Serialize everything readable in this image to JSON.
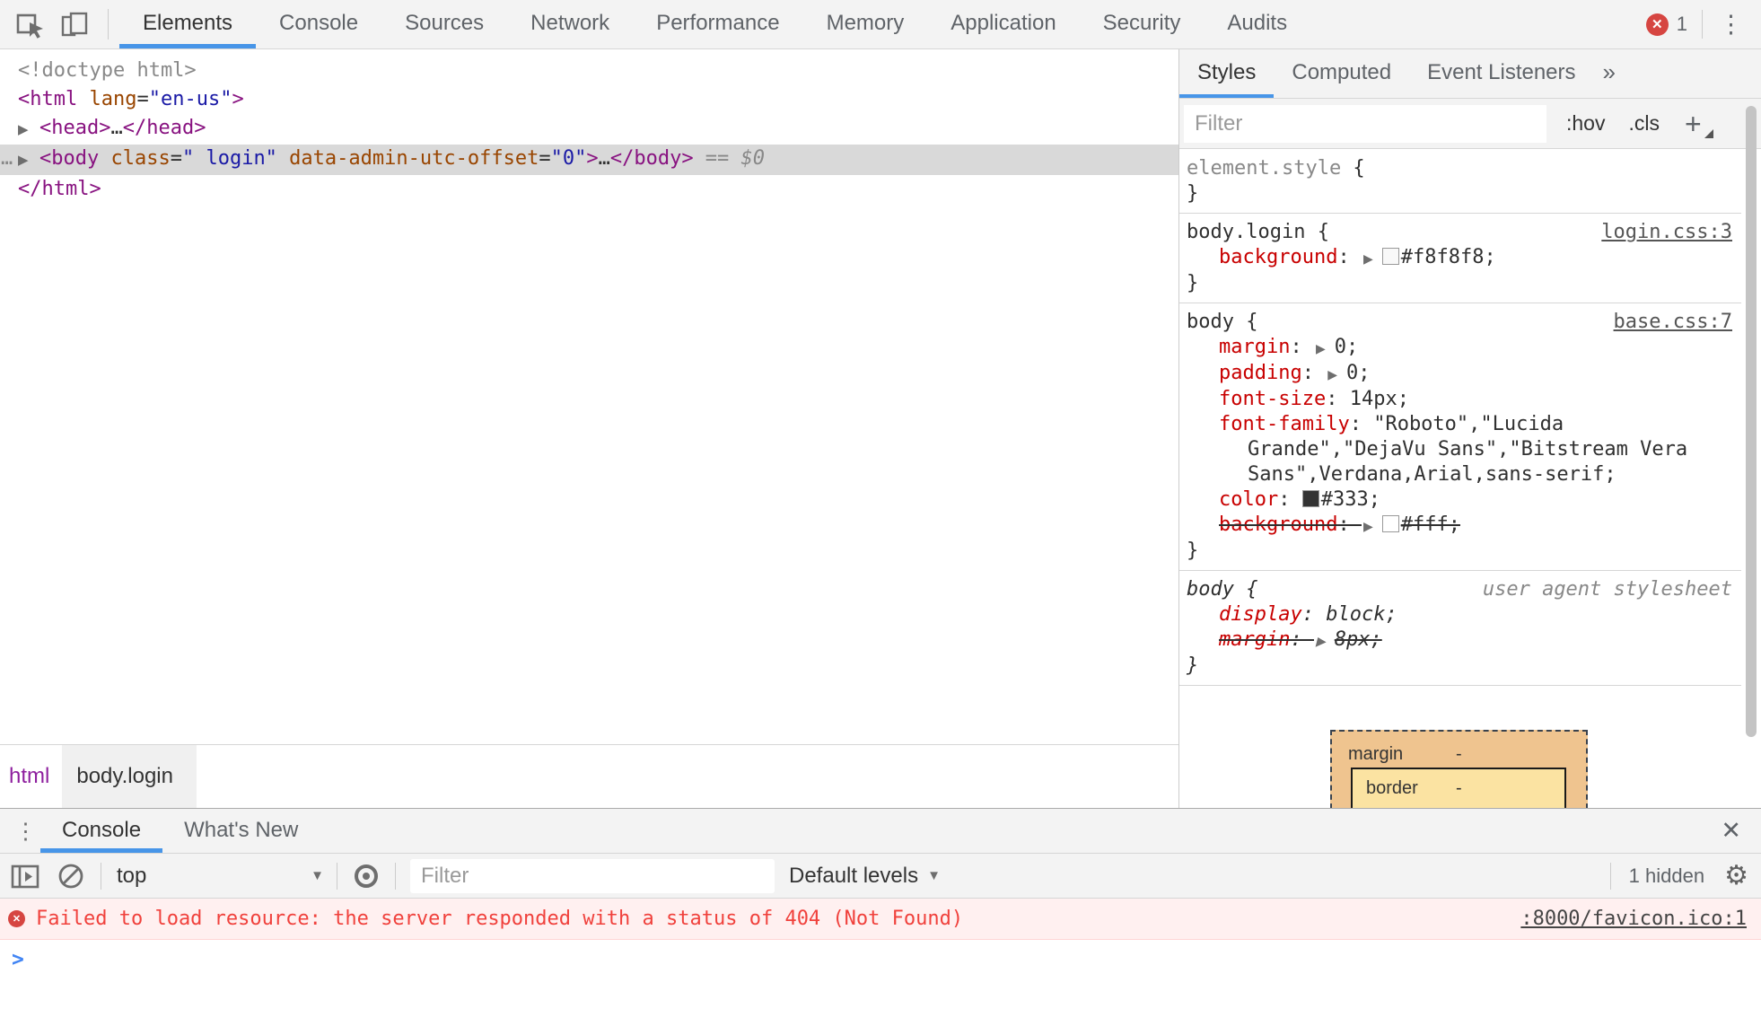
{
  "main_tabbar": {
    "tabs": [
      {
        "label": "Elements",
        "selected": true
      },
      {
        "label": "Console",
        "selected": false
      },
      {
        "label": "Sources",
        "selected": false
      },
      {
        "label": "Network",
        "selected": false
      },
      {
        "label": "Performance",
        "selected": false
      },
      {
        "label": "Memory",
        "selected": false
      },
      {
        "label": "Application",
        "selected": false
      },
      {
        "label": "Security",
        "selected": false
      },
      {
        "label": "Audits",
        "selected": false
      }
    ],
    "error_count": "1"
  },
  "elements_panel": {
    "code_lines": [
      {
        "tokens": [
          {
            "text": "<!doctype html>",
            "type": "comment"
          }
        ]
      },
      {
        "tokens": [
          {
            "text": "<html",
            "type": "tag"
          },
          {
            "text": " lang",
            "type": "attr"
          },
          {
            "text": "=",
            "type": "plain"
          },
          {
            "text": "\"en-us\"",
            "type": "value"
          },
          {
            "text": ">",
            "type": "tag"
          }
        ]
      },
      {
        "arrow": true,
        "tokens": [
          {
            "text": "<head>",
            "type": "tag"
          },
          {
            "text": "…",
            "type": "plain"
          },
          {
            "text": "</head>",
            "type": "tag"
          }
        ]
      },
      {
        "arrow": true,
        "selected": true,
        "gutter": "…",
        "tokens": [
          {
            "text": "<body",
            "type": "tag"
          },
          {
            "text": " class",
            "type": "attr"
          },
          {
            "text": "=",
            "type": "plain"
          },
          {
            "text": "\" login\"",
            "type": "value"
          },
          {
            "text": " data-admin-utc-offset",
            "type": "attr"
          },
          {
            "text": "=",
            "type": "plain"
          },
          {
            "text": "\"0\"",
            "type": "value"
          },
          {
            "text": ">",
            "type": "tag"
          },
          {
            "text": "…",
            "type": "plain"
          },
          {
            "text": "</body>",
            "type": "tag"
          },
          {
            "text": " == ",
            "type": "meta"
          },
          {
            "text": "$0",
            "type": "meta-italic"
          }
        ]
      },
      {
        "tokens": [
          {
            "text": "</html>",
            "type": "tag"
          }
        ]
      }
    ],
    "breadcrumb": [
      "html",
      "body.login"
    ]
  },
  "styles_panel": {
    "tabs": [
      {
        "label": "Styles",
        "selected": true
      },
      {
        "label": "Computed",
        "selected": false
      },
      {
        "label": "Event Listeners",
        "selected": false
      }
    ],
    "overflow_icon": "»",
    "filter_placeholder": "Filter",
    "pseudo_toggle": ":hov",
    "class_toggle": ".cls",
    "add_button": "+",
    "rules": [
      {
        "selector": "element.style",
        "selector_gray": true,
        "link": "",
        "properties": []
      },
      {
        "selector": "body.login",
        "link": "login.css:3",
        "properties": [
          {
            "name": "background",
            "arrow": true,
            "swatch": "#f8f8f8",
            "value": "#f8f8f8;"
          }
        ]
      },
      {
        "selector": "body",
        "link": "base.css:7",
        "properties": [
          {
            "name": "margin",
            "arrow": true,
            "value": "0;"
          },
          {
            "name": "padding",
            "arrow": true,
            "value": "0;"
          },
          {
            "name": "font-size",
            "value": "14px;"
          },
          {
            "name": "font-family",
            "value": "\"Roboto\",\"Lucida",
            "wrap_lines": [
              "Grande\",\"DejaVu Sans\",\"Bitstream Vera",
              "Sans\",Verdana,Arial,sans-serif;"
            ]
          },
          {
            "name": "color",
            "swatch": "#333333",
            "value": "#333;"
          },
          {
            "name": "background",
            "arrow": true,
            "swatch": "#ffffff",
            "value": "#fff;",
            "struck": true
          }
        ]
      },
      {
        "selector": "body",
        "italic": true,
        "link": "user agent stylesheet",
        "link_plain": true,
        "properties": [
          {
            "name": "display",
            "value": "block;"
          },
          {
            "name": "margin",
            "arrow": true,
            "value": "8px;",
            "struck": true
          }
        ]
      }
    ],
    "box_model": {
      "margin_label": "margin",
      "margin_value": "-",
      "border_label": "border",
      "border_value": "-"
    }
  },
  "console_drawer": {
    "tabs": [
      "Console",
      "What's New"
    ],
    "context": "top",
    "filter_placeholder": "Filter",
    "levels_label": "Default levels",
    "hidden_count": "1 hidden",
    "error": {
      "message": "Failed to load resource: the server responded with a status of 404 (Not Found)",
      "source": ":8000/favicon.ico:1"
    }
  },
  "icons": {
    "kebab": "⋮",
    "overflow": "»",
    "dropdown": "▼",
    "gear": "⚙",
    "close": "✕",
    "badge_x": "✕",
    "error_x": "✕",
    "prompt": ">"
  },
  "colors": {
    "accent": "#4795e8",
    "tag": "#881280",
    "attr_name": "#994500",
    "attr_value": "#1a1aa6",
    "property_name": "#c80000",
    "selection_bg": "#d9d9d9",
    "badge_red": "#d64541",
    "error_text": "#f0413c",
    "error_bg": "#fff0f0",
    "box_margin_fill": "#efc48f",
    "box_border_fill": "#fbe3a2"
  }
}
